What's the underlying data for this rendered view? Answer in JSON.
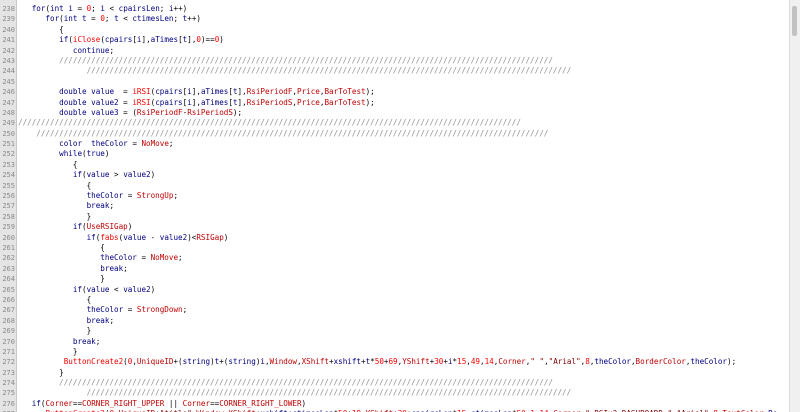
{
  "editor": {
    "lines": [
      {
        "n": "238",
        "text": "   for(int i = 0; i < cpairsLen; i++)"
      },
      {
        "n": "239",
        "text": "      for(int t = 0; t < ctimesLen; t++)"
      },
      {
        "n": "240",
        "text": "         {"
      },
      {
        "n": "241",
        "text": "         if(iClose(cpairs[i],aTimes[t],0)==0)"
      },
      {
        "n": "242",
        "text": "            continue;"
      },
      {
        "n": "243",
        "text": "         ////////////////////////////////////////////////////////////////////////////////////////////////////////////"
      },
      {
        "n": "244",
        "text": "               //////////////////////////////////////////////////////////////////////////////////////////////////////////"
      },
      {
        "n": "245",
        "text": ""
      },
      {
        "n": "246",
        "text": "         double value  = iRSI(cpairs[i],aTimes[t],RsiPeriodF,Price,BarToTest);"
      },
      {
        "n": "247",
        "text": "         double value2 = iRSI(cpairs[i],aTimes[t],RsiPeriodS,Price,BarToTest);"
      },
      {
        "n": "248",
        "text": "         double value3 = (RsiPeriodF-RsiPeriodS);"
      },
      {
        "n": "249",
        "text": "//////////////////////////////////////////////////////////////////////////////////////////////////////////////"
      },
      {
        "n": "250",
        "text": "    ////////////////////////////////////////////////////////////////////////////////////////////////////////////////"
      },
      {
        "n": "251",
        "text": "         color  theColor = NoMove;"
      },
      {
        "n": "252",
        "text": "         while(true)"
      },
      {
        "n": "253",
        "text": "            {"
      },
      {
        "n": "254",
        "text": "            if(value > value2)"
      },
      {
        "n": "255",
        "text": "               {"
      },
      {
        "n": "256",
        "text": "               theColor = StrongUp;"
      },
      {
        "n": "257",
        "text": "               break;"
      },
      {
        "n": "258",
        "text": "               }"
      },
      {
        "n": "259",
        "text": "            if(UseRSIGap)"
      },
      {
        "n": "260",
        "text": "               if(fabs(value - value2)<RSIGap)"
      },
      {
        "n": "261",
        "text": "                  {"
      },
      {
        "n": "262",
        "text": "                  theColor = NoMove;"
      },
      {
        "n": "263",
        "text": "                  break;"
      },
      {
        "n": "264",
        "text": "                  }"
      },
      {
        "n": "265",
        "text": "            if(value < value2)"
      },
      {
        "n": "266",
        "text": "               {"
      },
      {
        "n": "267",
        "text": "               theColor = StrongDown;"
      },
      {
        "n": "268",
        "text": "               break;"
      },
      {
        "n": "269",
        "text": "               }"
      },
      {
        "n": "270",
        "text": "            break;"
      },
      {
        "n": "271",
        "text": "            }"
      },
      {
        "n": "272",
        "text": "          ButtonCreate2(0,UniqueID+(string)t+(string)i,Window,XShift+xshift+t*50+69,YShift+30+i*15,49,14,Corner,\" \",\"Arial\",8,theColor,BorderColor,theColor);"
      },
      {
        "n": "273",
        "text": "         }"
      },
      {
        "n": "274",
        "text": "         ////////////////////////////////////////////////////////////////////////////////////////////////////////////"
      },
      {
        "n": "275",
        "text": "               //////////////////////////////////////////////////////////////////////////////////////////////////////////"
      },
      {
        "n": "276",
        "text": "   if(Corner==CORNER_RIGHT_UPPER || Corner==CORNER_RIGHT_LOWER)"
      },
      {
        "n": "277",
        "text": "      ButtonCreate2(0,UniqueID+\"title\",Window,XShift+xshift+ctimesLen*50+19,YShift+30+cpairsLen*15,ctimesLen*50-1,14,Corner,\" RSIx2 DASHBOARD \",\"Arial\",8,TextColor,Bo"
      }
    ]
  }
}
